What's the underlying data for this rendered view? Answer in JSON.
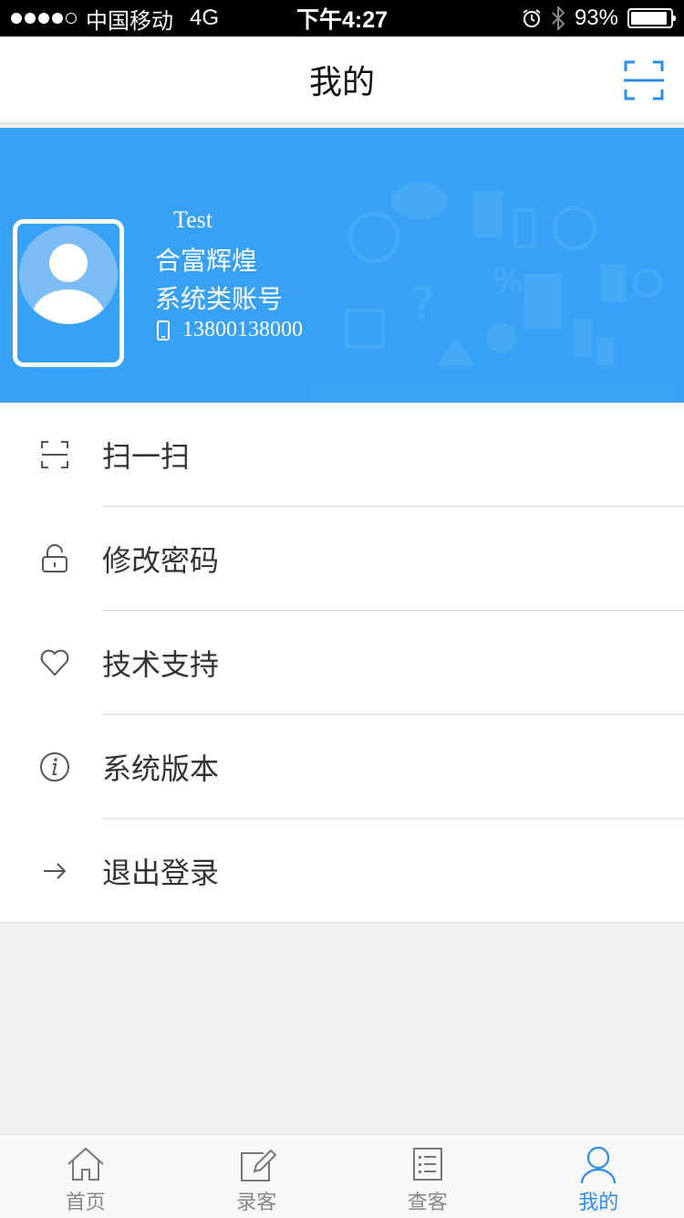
{
  "status_bar": {
    "carrier": "中国移动",
    "network": "4G",
    "time": "下午4:27",
    "battery": "93%",
    "battery_level": 0.93
  },
  "nav": {
    "title": "我的"
  },
  "profile": {
    "name": "Test",
    "company": "合富辉煌",
    "account_type": "系统类账号",
    "phone": "13800138000"
  },
  "menu": {
    "items": [
      {
        "label": "扫一扫",
        "icon": "scan-icon"
      },
      {
        "label": "修改密码",
        "icon": "lock-icon"
      },
      {
        "label": "技术支持",
        "icon": "heart-icon"
      },
      {
        "label": "系统版本",
        "icon": "info-icon"
      },
      {
        "label": "退出登录",
        "icon": "arrow-right-icon"
      }
    ]
  },
  "tabs": {
    "items": [
      {
        "label": "首页",
        "icon": "home-icon"
      },
      {
        "label": "录客",
        "icon": "edit-icon"
      },
      {
        "label": "查客",
        "icon": "list-icon"
      },
      {
        "label": "我的",
        "icon": "user-icon"
      }
    ],
    "active_index": 3
  },
  "colors": {
    "accent": "#37a2f5",
    "tab_active": "#2a8ef0"
  }
}
